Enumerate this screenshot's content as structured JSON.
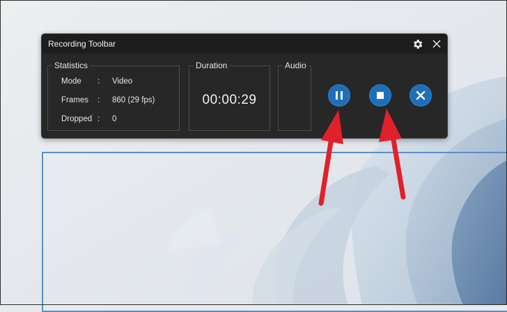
{
  "toolbar": {
    "title": "Recording Toolbar",
    "settings_icon": "gear-icon",
    "close_icon": "close-icon"
  },
  "statistics": {
    "label": "Statistics",
    "rows": [
      {
        "key": "Mode",
        "sep": ":",
        "value": "Video"
      },
      {
        "key": "Frames",
        "sep": ":",
        "value": "860 (29 fps)"
      },
      {
        "key": "Dropped",
        "sep": ":",
        "value": "0"
      }
    ]
  },
  "duration": {
    "label": "Duration",
    "value": "00:00:29"
  },
  "audio": {
    "label": "Audio"
  },
  "controls": {
    "pause_icon": "pause-icon",
    "stop_icon": "stop-icon",
    "cancel_icon": "cancel-icon"
  },
  "colors": {
    "toolbar_bg": "#272727",
    "button_blue": "#1f6fb8",
    "arrow_red": "#e0202a",
    "selection_border": "#5b8ec4"
  }
}
